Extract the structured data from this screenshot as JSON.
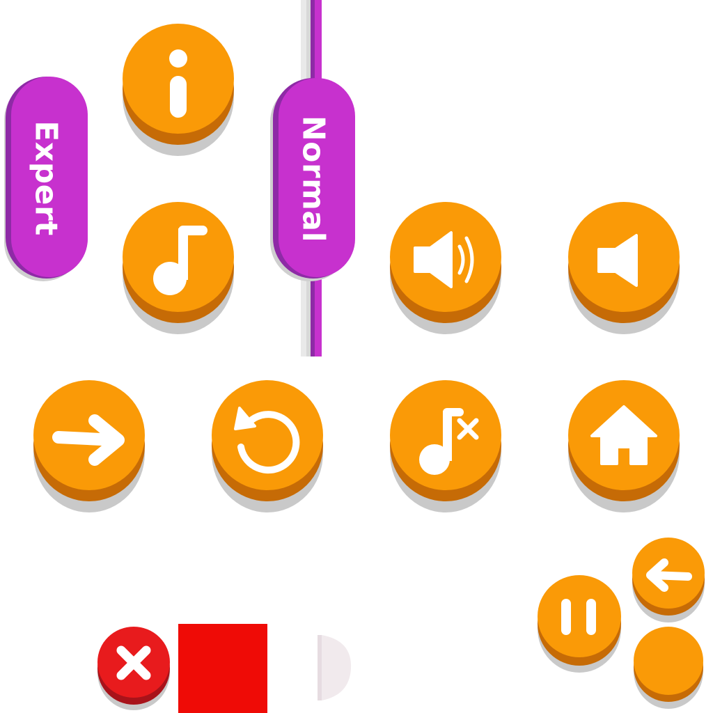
{
  "colors": {
    "button_face": "#fa9a07",
    "button_base": "#c66b06",
    "pill_face": "#c731ce",
    "pill_base": "#8e2aa6",
    "close_face": "#e81b1d",
    "swatch": "#ef0b06"
  },
  "difficulty": {
    "expert_label": "Expert",
    "normal_label": "Normal"
  },
  "icons": {
    "info": "info-icon",
    "music": "music-note-icon",
    "sound_on": "speaker-on-icon",
    "sound_off": "speaker-off-icon",
    "next": "arrow-right-icon",
    "restart": "restart-icon",
    "music_off": "music-off-icon",
    "home": "home-icon",
    "back": "arrow-left-icon",
    "pause": "pause-icon",
    "close": "close-icon"
  }
}
